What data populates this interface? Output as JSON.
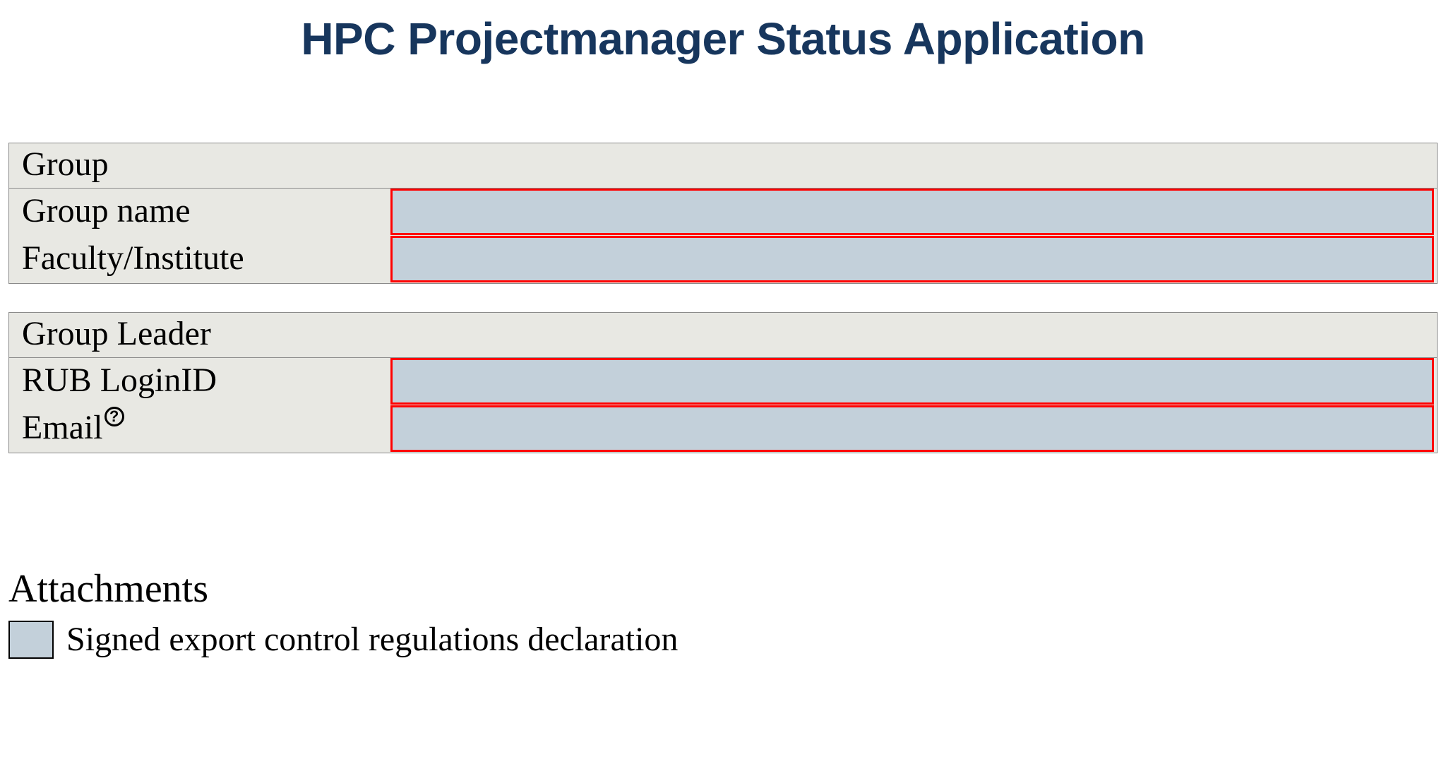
{
  "title": "HPC Projectmanager Status Application",
  "sections": {
    "group": {
      "header": "Group",
      "rows": {
        "group_name": {
          "label": "Group name",
          "value": ""
        },
        "faculty": {
          "label": "Faculty/Institute",
          "value": ""
        }
      }
    },
    "leader": {
      "header": "Group Leader",
      "rows": {
        "login": {
          "label": "RUB LoginID",
          "value": ""
        },
        "email": {
          "label": "Email",
          "value": "",
          "help": "?"
        }
      }
    }
  },
  "attachments": {
    "heading": "Attachments",
    "item": "Signed export control regulations declaration"
  }
}
